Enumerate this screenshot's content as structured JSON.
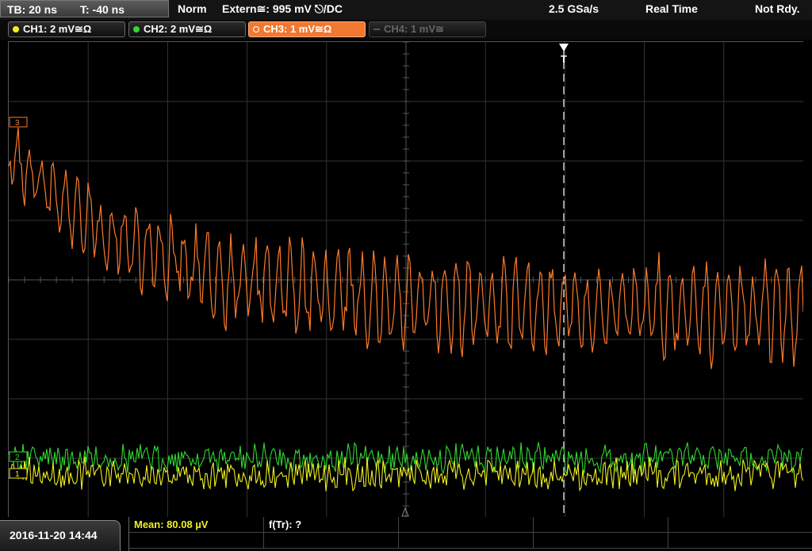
{
  "header": {
    "timebase": "TB: 20 ns",
    "trigger_time": "T: -40 ns",
    "trigger_mode": "Norm",
    "trigger_source": "Extern≅: 995 mV ⎋/DC",
    "sample_rate": "2.5 GSa/s",
    "acq_mode": "Real Time",
    "status": "Not Rdy."
  },
  "channels": [
    {
      "label": "CH1: 2 mV≅Ω",
      "color": "#f0f020",
      "state": "on"
    },
    {
      "label": "CH2: 2 mV≅Ω",
      "color": "#30d830",
      "state": "on"
    },
    {
      "label": "CH3: 1 mV≅Ω",
      "color": "#ff7a2a",
      "state": "selected"
    },
    {
      "label": "CH4: 1 mV≅",
      "color": "#555555",
      "state": "off"
    }
  ],
  "footer": {
    "datetime": "2016-11-20 14:44",
    "measurement_1": "Mean: 80.08 µV",
    "measurement_2": "f(Tr): ?"
  },
  "markers": {
    "trigger_marker": "T",
    "ch1_marker": "1",
    "ch2_marker": "2",
    "ch3_marker": "3"
  },
  "colors": {
    "ch1": "#f0f020",
    "ch2": "#30d830",
    "ch3": "#ff7a2a",
    "grid": "#3a3a3a",
    "measurement_text": "#f0f020"
  }
}
